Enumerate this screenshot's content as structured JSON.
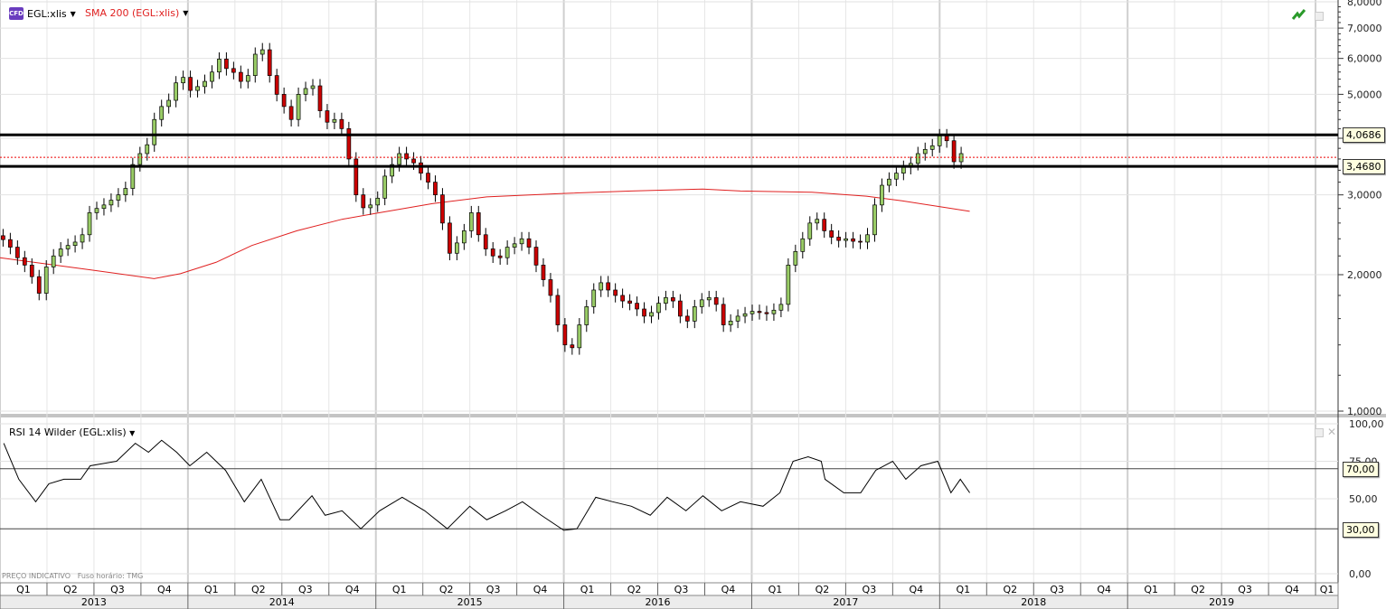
{
  "legend": {
    "instrument": "EGL:xlis",
    "instrument_icon": "CFD",
    "indicator": "SMA 200 (EGL:xlis)",
    "rsi": "RSI 14 Wilder (EGL:xlis)"
  },
  "footer": {
    "note": "PREÇO INDICATIVO",
    "timezone": "Fuso horário: TMG"
  },
  "colors": {
    "up": "#99cc66",
    "down": "#cc0000",
    "sma": "#e02020",
    "level": "#000000"
  },
  "chart_data": [
    {
      "type": "candlestick",
      "scale": "log",
      "ylim": [
        1,
        8
      ],
      "y_ticks": [
        "8,0000",
        "7,0000",
        "6,0000",
        "5,0000",
        "4,0000",
        "3,0000",
        "2,0000",
        "1,0000"
      ],
      "y_tick_values": [
        8,
        7,
        6,
        5,
        4,
        3,
        2,
        1
      ],
      "xlim": [
        2013.0,
        2020.12
      ],
      "quarters": [
        "Q1",
        "Q2",
        "Q3",
        "Q4"
      ],
      "years": [
        "2013",
        "2014",
        "2015",
        "2016",
        "2017",
        "2018",
        "2019"
      ],
      "extra_quarter": "Q1",
      "grid": true,
      "first_date": "2013-01-07",
      "period_weeks": 2,
      "closes": [
        2.39,
        2.3,
        2.18,
        2.1,
        1.98,
        1.82,
        2.08,
        2.2,
        2.28,
        2.32,
        2.36,
        2.45,
        2.74,
        2.8,
        2.85,
        2.92,
        3.0,
        3.1,
        3.5,
        3.7,
        3.87,
        4.4,
        4.7,
        4.85,
        5.3,
        5.45,
        5.1,
        5.2,
        5.34,
        5.6,
        5.98,
        5.7,
        5.59,
        5.34,
        5.5,
        6.13,
        6.27,
        5.5,
        5.0,
        4.7,
        4.4,
        5.0,
        5.15,
        5.22,
        4.6,
        4.34,
        4.4,
        4.2,
        3.6,
        3.0,
        2.81,
        2.85,
        2.95,
        3.3,
        3.5,
        3.7,
        3.6,
        3.53,
        3.35,
        3.2,
        3.0,
        2.6,
        2.23,
        2.35,
        2.5,
        2.74,
        2.45,
        2.28,
        2.2,
        2.18,
        2.3,
        2.34,
        2.4,
        2.3,
        2.1,
        1.95,
        1.8,
        1.55,
        1.4,
        1.38,
        1.55,
        1.7,
        1.85,
        1.92,
        1.85,
        1.8,
        1.75,
        1.73,
        1.68,
        1.62,
        1.65,
        1.73,
        1.78,
        1.75,
        1.62,
        1.58,
        1.7,
        1.76,
        1.78,
        1.72,
        1.55,
        1.58,
        1.62,
        1.64,
        1.66,
        1.65,
        1.64,
        1.67,
        1.72,
        2.1,
        2.25,
        2.4,
        2.6,
        2.65,
        2.5,
        2.42,
        2.38,
        2.4,
        2.37,
        2.36,
        2.45,
        2.85,
        3.15,
        3.25,
        3.35,
        3.45,
        3.52,
        3.7,
        3.78,
        3.85,
        4.05,
        3.95,
        3.55,
        3.7
      ],
      "sma_200": [
        [
          2013.0,
          2.18
        ],
        [
          2013.48,
          2.05
        ],
        [
          2013.82,
          1.96
        ],
        [
          2013.96,
          2.01
        ],
        [
          2014.15,
          2.13
        ],
        [
          2014.34,
          2.32
        ],
        [
          2014.58,
          2.5
        ],
        [
          2014.82,
          2.65
        ],
        [
          2015.02,
          2.74
        ],
        [
          2015.3,
          2.87
        ],
        [
          2015.59,
          2.97
        ],
        [
          2015.98,
          3.02
        ],
        [
          2016.36,
          3.06
        ],
        [
          2016.74,
          3.09
        ],
        [
          2016.94,
          3.06
        ],
        [
          2017.32,
          3.04
        ],
        [
          2017.61,
          2.98
        ],
        [
          2017.8,
          2.91
        ],
        [
          2017.99,
          2.83
        ],
        [
          2018.16,
          2.76
        ]
      ],
      "levels": [
        {
          "value": 4.0686,
          "label": "4,0686"
        },
        {
          "value": 3.468,
          "label": "3,4680"
        }
      ],
      "last_price_line": 3.63
    },
    {
      "type": "line",
      "name": "RSI 14 Wilder (EGL:xlis)",
      "ylim": [
        0,
        100
      ],
      "y_ticks": [
        "100,00",
        "75,00",
        "50,00",
        "0,00"
      ],
      "y_tick_values": [
        100,
        75,
        50,
        0
      ],
      "bands": [
        {
          "value": 70,
          "label": "70,00"
        },
        {
          "value": 30,
          "label": "30,00"
        }
      ],
      "points": [
        [
          2013.02,
          87
        ],
        [
          2013.1,
          63
        ],
        [
          2013.19,
          48
        ],
        [
          2013.26,
          60
        ],
        [
          2013.34,
          63
        ],
        [
          2013.43,
          63
        ],
        [
          2013.48,
          72
        ],
        [
          2013.62,
          75
        ],
        [
          2013.72,
          87
        ],
        [
          2013.79,
          81
        ],
        [
          2013.86,
          89
        ],
        [
          2013.94,
          81
        ],
        [
          2014.01,
          72
        ],
        [
          2014.1,
          81
        ],
        [
          2014.2,
          69
        ],
        [
          2014.3,
          48
        ],
        [
          2014.39,
          63
        ],
        [
          2014.49,
          36
        ],
        [
          2014.54,
          36
        ],
        [
          2014.66,
          52
        ],
        [
          2014.73,
          39
        ],
        [
          2014.82,
          42
        ],
        [
          2014.92,
          30
        ],
        [
          2015.02,
          42
        ],
        [
          2015.14,
          51
        ],
        [
          2015.26,
          42
        ],
        [
          2015.38,
          30
        ],
        [
          2015.5,
          45
        ],
        [
          2015.59,
          36
        ],
        [
          2015.69,
          42
        ],
        [
          2015.78,
          48
        ],
        [
          2015.88,
          39
        ],
        [
          2016.0,
          29
        ],
        [
          2016.07,
          30
        ],
        [
          2016.17,
          51
        ],
        [
          2016.26,
          48
        ],
        [
          2016.36,
          45
        ],
        [
          2016.46,
          39
        ],
        [
          2016.55,
          51
        ],
        [
          2016.65,
          42
        ],
        [
          2016.74,
          52
        ],
        [
          2016.84,
          42
        ],
        [
          2016.94,
          48
        ],
        [
          2017.06,
          45
        ],
        [
          2017.15,
          54
        ],
        [
          2017.22,
          75
        ],
        [
          2017.3,
          78
        ],
        [
          2017.37,
          75
        ],
        [
          2017.39,
          63
        ],
        [
          2017.49,
          54
        ],
        [
          2017.58,
          54
        ],
        [
          2017.66,
          69
        ],
        [
          2017.75,
          75
        ],
        [
          2017.82,
          63
        ],
        [
          2017.9,
          72
        ],
        [
          2017.99,
          75
        ],
        [
          2018.06,
          54
        ],
        [
          2018.11,
          63
        ],
        [
          2018.16,
          54
        ]
      ]
    }
  ]
}
